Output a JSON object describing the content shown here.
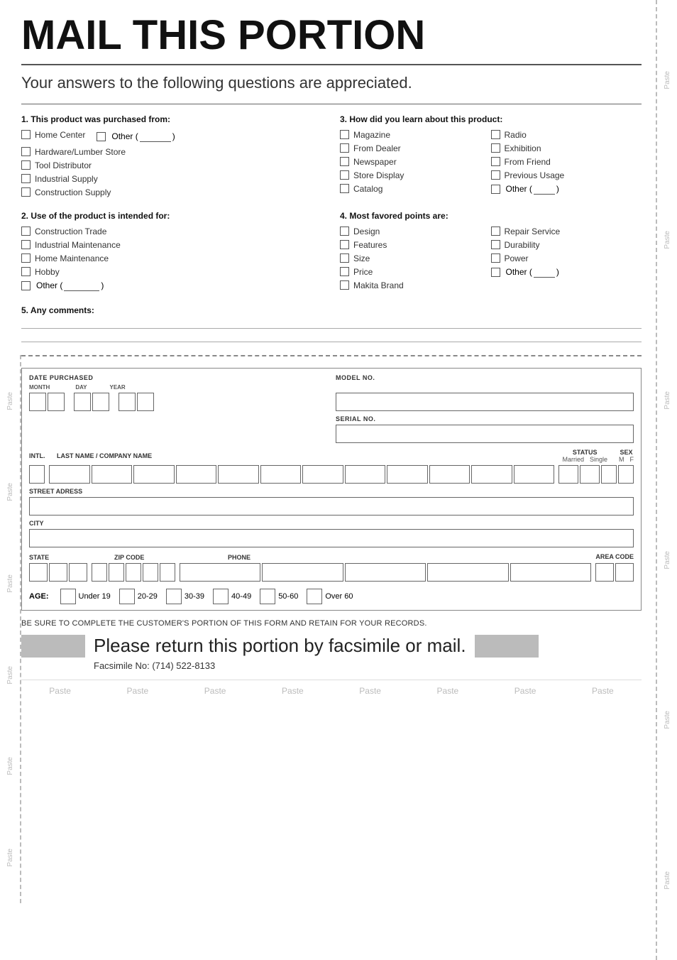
{
  "title": "MAIL THIS PORTION",
  "subtitle": "Your answers to the following questions are appreciated.",
  "q1": {
    "title": "1. This product was purchased from:",
    "items": [
      "Home Center",
      "Hardware/Lumber Store",
      "Tool Distributor",
      "Industrial Supply",
      "Construction Supply"
    ],
    "other_label": "Other ("
  },
  "q2": {
    "title": "2. Use of the product is intended for:",
    "items": [
      "Construction Trade",
      "Industrial Maintenance",
      "Home Maintenance",
      "Hobby",
      "Other ("
    ]
  },
  "q3": {
    "title": "3. How did you learn about this product:",
    "col1": [
      "Magazine",
      "From Dealer",
      "Newspaper",
      "Store Display",
      "Catalog"
    ],
    "col2": [
      "Radio",
      "Exhibition",
      "From Friend",
      "Previous Usage",
      "Other ("
    ]
  },
  "q4": {
    "title": "4. Most favored points are:",
    "col1": [
      "Design",
      "Features",
      "Size",
      "Price",
      "Makita Brand"
    ],
    "col2": [
      "Repair Service",
      "Durability",
      "Power",
      "Other ("
    ]
  },
  "q5": {
    "title": "5. Any comments:"
  },
  "form": {
    "date_purchased": "DATE PURCHASED",
    "month": "MONTH",
    "day": "DAY",
    "year": "YEAR",
    "model_no": "MODEL NO.",
    "serial_no": "SERIAL NO.",
    "intl": "INTL.",
    "last_name": "LAST NAME / COMPANY NAME",
    "status": "STATUS",
    "sex": "SEX",
    "married": "Married",
    "single": "Single",
    "m": "M",
    "f": "F",
    "street": "STREET ADRESS",
    "city": "CITY",
    "state": "STATE",
    "zip": "ZIP CODE",
    "phone": "PHONE",
    "area_code": "AREA CODE",
    "age_label": "AGE:",
    "age_options": [
      "Under 19",
      "20-29",
      "30-39",
      "40-49",
      "50-60",
      "Over 60"
    ],
    "reminder": "BE SURE TO COMPLETE THE CUSTOMER'S PORTION OF THIS FORM AND RETAIN FOR YOUR RECORDS.",
    "return_text": "Please return this portion by facsimile or mail.",
    "fax": "Facsimile No: (714) 522-8133"
  },
  "paste_labels": [
    "Paste",
    "Paste",
    "Paste",
    "Paste",
    "Paste",
    "Paste",
    "Paste",
    "Paste"
  ],
  "side_pastes": [
    "Paste",
    "Paste",
    "Paste",
    "Paste",
    "Paste",
    "Paste",
    "Paste",
    "Paste"
  ]
}
